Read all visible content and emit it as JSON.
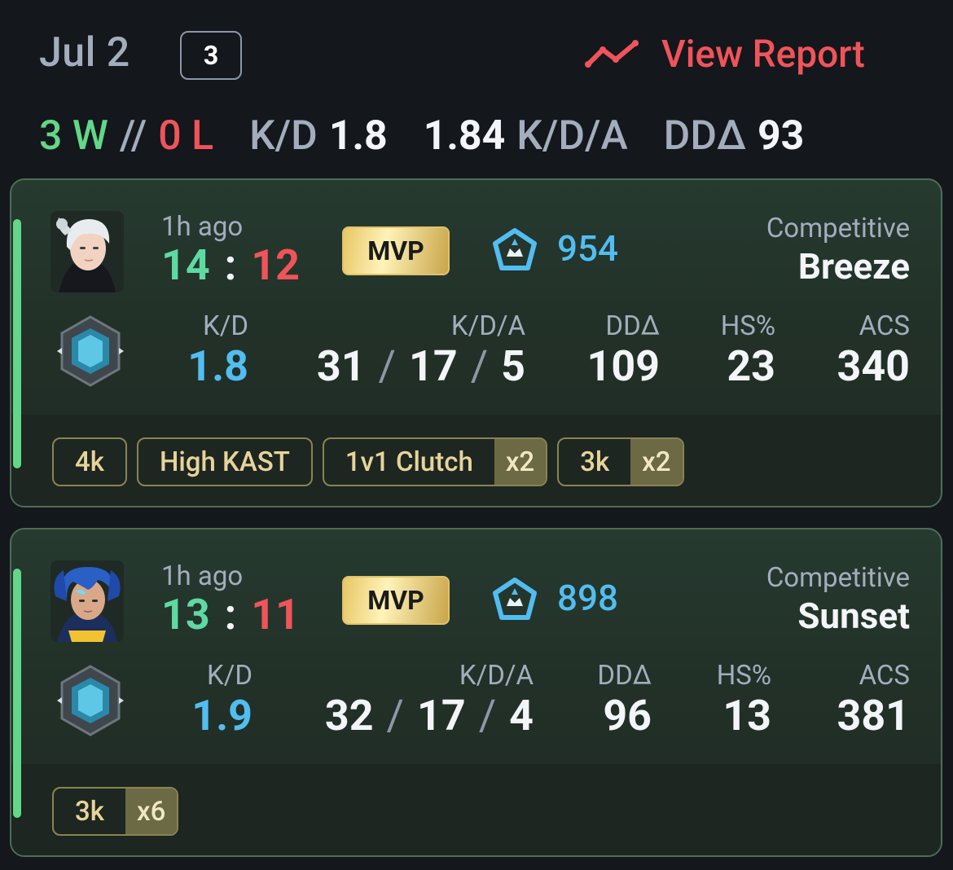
{
  "header": {
    "date": "Jul 2",
    "match_count": "3",
    "view_report_label": "View Report"
  },
  "summary": {
    "wins": "3 W",
    "sep": "//",
    "losses": "0 L",
    "kd_label": "K/D",
    "kd_value": "1.8",
    "kda_value": "1.84",
    "kda_label": "K/D/A",
    "dda_label": "DDΔ",
    "dda_value": "93"
  },
  "labels": {
    "kd": "K/D",
    "kda": "K/D/A",
    "dda": "DDΔ",
    "hs": "HS%",
    "acs": "ACS",
    "mvp": "MVP",
    "colon": ":",
    "slash": "/"
  },
  "matches": [
    {
      "ago": "1h ago",
      "score_won": "14",
      "score_lost": "12",
      "rr": "954",
      "mode": "Competitive",
      "map": "Breeze",
      "kd": "1.8",
      "kills": "31",
      "deaths": "17",
      "assists": "5",
      "dda": "109",
      "hs": "23",
      "acs": "340",
      "tags": [
        {
          "label": "4k",
          "mult": ""
        },
        {
          "label": "High KAST",
          "mult": ""
        },
        {
          "label": "1v1 Clutch",
          "mult": "x2"
        },
        {
          "label": "3k",
          "mult": "x2"
        }
      ]
    },
    {
      "ago": "1h ago",
      "score_won": "13",
      "score_lost": "11",
      "rr": "898",
      "mode": "Competitive",
      "map": "Sunset",
      "kd": "1.9",
      "kills": "32",
      "deaths": "17",
      "assists": "4",
      "dda": "96",
      "hs": "13",
      "acs": "381",
      "tags": [
        {
          "label": "3k",
          "mult": "x6"
        }
      ]
    }
  ],
  "colors": {
    "win": "#62d788",
    "loss": "#f0545a",
    "accent_blue": "#52bdf0",
    "card_border": "#4c6e57",
    "tag_gold": "#e7d49a"
  },
  "icons": {
    "report": "trend-line-icon",
    "rank": "radiant-rank-icon",
    "badge": "platinum-rank-badge-icon",
    "agent_1": "jett-agent-icon",
    "agent_2": "neon-agent-icon"
  }
}
